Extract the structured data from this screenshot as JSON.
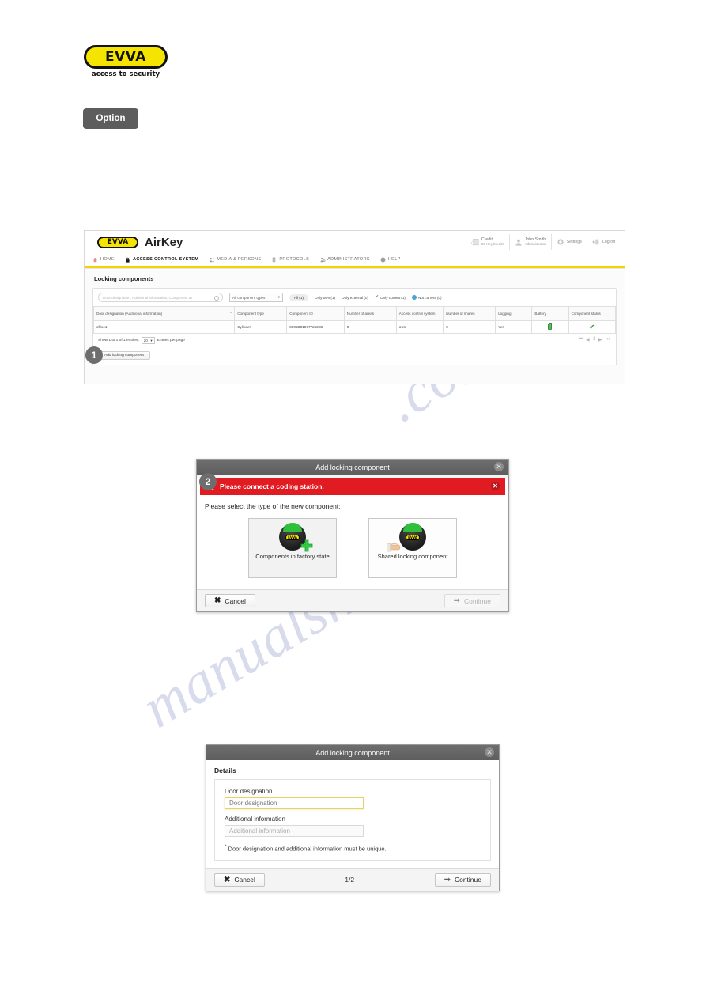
{
  "brand": {
    "logo_text": "EVVA",
    "tagline": "access to security"
  },
  "option_button": {
    "label": "Option"
  },
  "watermark": {
    "line1": "manualshive",
    "line2": ".com"
  },
  "app": {
    "header": {
      "logo_text": "EVVA",
      "title": "AirKey",
      "credit": {
        "label": "Credit",
        "value": "50 KeyCredits",
        "icon": "credit-card-icon"
      },
      "user": {
        "name": "John Smith",
        "role": "Administrator",
        "icon": "user-icon"
      },
      "settings": {
        "label": "Settings",
        "icon": "gear-icon"
      },
      "logoff": {
        "label": "Log off",
        "icon": "logout-icon"
      }
    },
    "nav": [
      {
        "label": "HOME",
        "icon": "home-icon",
        "active": false
      },
      {
        "label": "ACCESS CONTROL SYSTEM",
        "icon": "lock-icon",
        "active": true
      },
      {
        "label": "MEDIA & PERSONS",
        "icon": "people-icon",
        "active": false
      },
      {
        "label": "PROTOCOLS",
        "icon": "document-icon",
        "active": false
      },
      {
        "label": "ADMINISTRATORS",
        "icon": "admin-icon",
        "active": false
      },
      {
        "label": "HELP",
        "icon": "help-icon",
        "active": false
      }
    ],
    "page_title": "Locking components",
    "filters": {
      "search_placeholder": "Door designation, Additional information, Component ID",
      "component_type_select": "All component types",
      "chips": [
        {
          "label": "All (1)",
          "icon": "none"
        },
        {
          "label": "Only own (1)",
          "icon": "none"
        },
        {
          "label": "Only external (0)",
          "icon": "none"
        },
        {
          "label": "Only current (1)",
          "icon": "green-check-icon"
        },
        {
          "label": "Not current (0)",
          "icon": "blue-sync-icon"
        }
      ]
    },
    "table": {
      "columns": [
        "Door designation (Additional information)",
        "Component type",
        "Component ID",
        "Number of areas",
        "Access control system",
        "Number of shares",
        "Logging",
        "Battery",
        "Component status"
      ],
      "rows": [
        {
          "door_designation": "office1",
          "component_type": "Cylinder",
          "component_id": "0005D015777253C5",
          "number_of_areas": "0",
          "access_control_system": "own",
          "number_of_shares": "0",
          "logging": "Yes",
          "battery": "battery-full-icon",
          "component_status": "green-check-icon"
        }
      ]
    },
    "footer": {
      "entries_prefix": "Show 1 to 1 of 1 entries,",
      "entries_per_page_value": "20",
      "entries_suffix": "Entries per page",
      "add_button": "Add locking component",
      "pager": [
        "first-page-icon",
        "prev-page-icon",
        "1",
        "next-page-icon",
        "last-page-icon"
      ]
    }
  },
  "badges": {
    "one": "1",
    "two": "2"
  },
  "dialog_select": {
    "title": "Add locking component",
    "close_icon": "close-icon",
    "alert": {
      "message": "Please connect a coding station.",
      "icon": "warning-triangle-icon",
      "close_icon": "close-icon"
    },
    "instruction": "Please select the type of the new component:",
    "cards": [
      {
        "label": "Components in factory state",
        "icon": "knob-plus-icon",
        "selected": true
      },
      {
        "label": "Shared locking component",
        "icon": "knob-hand-icon",
        "selected": false
      }
    ],
    "cancel": "Cancel",
    "continue": "Continue",
    "continue_disabled": true
  },
  "dialog_details": {
    "title": "Add locking component",
    "close_icon": "close-icon",
    "section_title": "Details",
    "fields": [
      {
        "label": "Door designation",
        "placeholder": "Door designation",
        "value": "",
        "focused": true
      },
      {
        "label": "Additional information",
        "placeholder": "Additional information",
        "value": "",
        "focused": false
      }
    ],
    "hint": "Door designation and additional information must be unique.",
    "hint_marker": "*",
    "cancel": "Cancel",
    "page_indicator": "1/2",
    "continue": "Continue"
  }
}
